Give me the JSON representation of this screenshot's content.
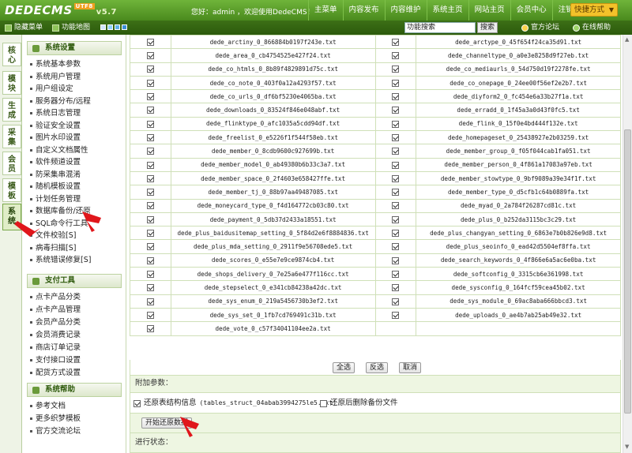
{
  "header": {
    "logo": "DEDECMS",
    "version": "v5.7",
    "badge": "UTF8",
    "welcome": "您好：admin ，欢迎使用DedeCMS！",
    "nav": [
      "主菜单",
      "内容发布",
      "内容维护",
      "系统主页",
      "网站主页",
      "会员中心",
      "注销"
    ],
    "quick_menu": "快捷方式"
  },
  "subbar": {
    "hide_menu": "隐藏菜单",
    "func_map": "功能地图",
    "search_value": "功能搜索",
    "search_button": "搜索",
    "official_forum": "官方论坛",
    "online_help": "在线帮助"
  },
  "colors": {
    "header_green": "#5a9e2a",
    "subbar_green": "#356612",
    "accent": "#2e5a0c",
    "arrow_red": "#e0161b"
  },
  "vtabs": [
    {
      "label": "核心"
    },
    {
      "label": "模块"
    },
    {
      "label": "生成"
    },
    {
      "label": "采集"
    },
    {
      "label": "会员"
    },
    {
      "label": "模板"
    },
    {
      "label": "系统",
      "active": true
    }
  ],
  "sidebar": {
    "sections": [
      {
        "title": "系统设置",
        "items": [
          "系统基本参数",
          "系统用户管理",
          "用户组设定",
          "服务器分布/远程",
          "系统日志管理",
          "验证安全设置",
          "图片水印设置",
          "自定义文档属性",
          "软件频道设置",
          "防采集串混淆",
          "随机模板设置",
          "计划任务管理",
          "数据库备份/还原",
          "SQL命令行工具",
          "文件校验[S]",
          "病毒扫描[S]",
          "系统错误修复[S]"
        ]
      },
      {
        "title": "支付工具",
        "items": [
          "点卡产品分类",
          "点卡产品管理",
          "会员产品分类",
          "会员消费记录",
          "商店订单记录",
          "支付接口设置",
          "配货方式设置"
        ]
      },
      {
        "title": "系统帮助",
        "items": [
          "参考文档",
          "更多织梦模板",
          "官方交流论坛"
        ]
      }
    ]
  },
  "files": [
    [
      "dede_arctiny_0_866884b0197f243e.txt",
      "dede_arctype_0_45f654f24ca35d91.txt"
    ],
    [
      "dede_area_0_cb4754525e427f24.txt",
      "dede_channeltype_0_a0e3e8258d9f27eb.txt"
    ],
    [
      "dede_co_htmls_0_8b89f4829891d75c.txt",
      "dede_co_mediaurls_0_54d750d19f2278fe.txt"
    ],
    [
      "dede_co_note_0_403f0a12a4293f57.txt",
      "dede_co_onepage_0_24ee00f56ef2e2b7.txt"
    ],
    [
      "dede_co_urls_0_df6bf5230e4065ba.txt",
      "dede_diyform2_0_fc454e6a33b27f1a.txt"
    ],
    [
      "dede_downloads_0_83524f846e048abf.txt",
      "dede_erradd_0_1f45a3a0d43f0fc5.txt"
    ],
    [
      "dede_flinktype_0_afc1035a5cdd94df.txt",
      "dede_flink_0_15f0e4bd444f132e.txt"
    ],
    [
      "dede_freelist_0_e5226f1f544f58eb.txt",
      "dede_homepageset_0_25438927e2b03259.txt"
    ],
    [
      "dede_member_0_8cdb9600c927699b.txt",
      "dede_member_group_0_f05f044cab1fa051.txt"
    ],
    [
      "dede_member_model_0_ab49380b6b33c3a7.txt",
      "dede_member_person_0_4f861a17083a97eb.txt"
    ],
    [
      "dede_member_space_0_2f4603e658427ffe.txt",
      "dede_member_stowtype_0_9bf9089a39e34f1f.txt"
    ],
    [
      "dede_member_tj_0_88b97aa49487085.txt",
      "dede_member_type_0_d5cfb1c64b0889fa.txt"
    ],
    [
      "dede_moneycard_type_0_f4d164772cb03c80.txt",
      "dede_myad_0_2a784f26287cd81c.txt"
    ],
    [
      "dede_payment_0_5db37d2433a18551.txt",
      "dede_plus_0_b252da3115bc3c29.txt"
    ],
    [
      "dede_plus_baidusitemap_setting_0_5f84d2e6f8884836.txt",
      "dede_plus_changyan_setting_0_6863e7b0b826e9d8.txt"
    ],
    [
      "dede_plus_mda_setting_0_2911f9e56708ede5.txt",
      "dede_plus_seoinfo_0_ead42d5504ef8ffa.txt"
    ],
    [
      "dede_scores_0_e55e7e9ce9874cb4.txt",
      "dede_search_keywords_0_4f866e6a5ac6e0ba.txt"
    ],
    [
      "dede_shops_delivery_0_7e25a6e477f116cc.txt",
      "dede_softconfig_0_3315cb6e361998.txt"
    ],
    [
      "dede_stepselect_0_e341cb84238a42dc.txt",
      "dede_sysconfig_0_164fcf59cea45b02.txt"
    ],
    [
      "dede_sys_enum_0_219a5456730b3ef2.txt",
      "dede_sys_module_0_69ac8aba666bbcd3.txt"
    ],
    [
      "dede_sys_set_0_1fb7cd769491c31b.txt",
      "dede_uploads_0_ae4b7ab25ab49e32.txt"
    ],
    [
      "dede_vote_0_c57f34041104ee2a.txt",
      ""
    ]
  ],
  "actions": {
    "select_all": "全选",
    "invert": "反选",
    "cancel": "取消"
  },
  "params": {
    "title": "附加参数：",
    "restore_struct_label": "还原表结构信息",
    "restore_struct_file": "(tables_struct_04abab3994275le5.txt)",
    "delete_backup_label": "还原后删除备份文件",
    "start_button": "开始还原数据",
    "status_title": "进行状态："
  }
}
